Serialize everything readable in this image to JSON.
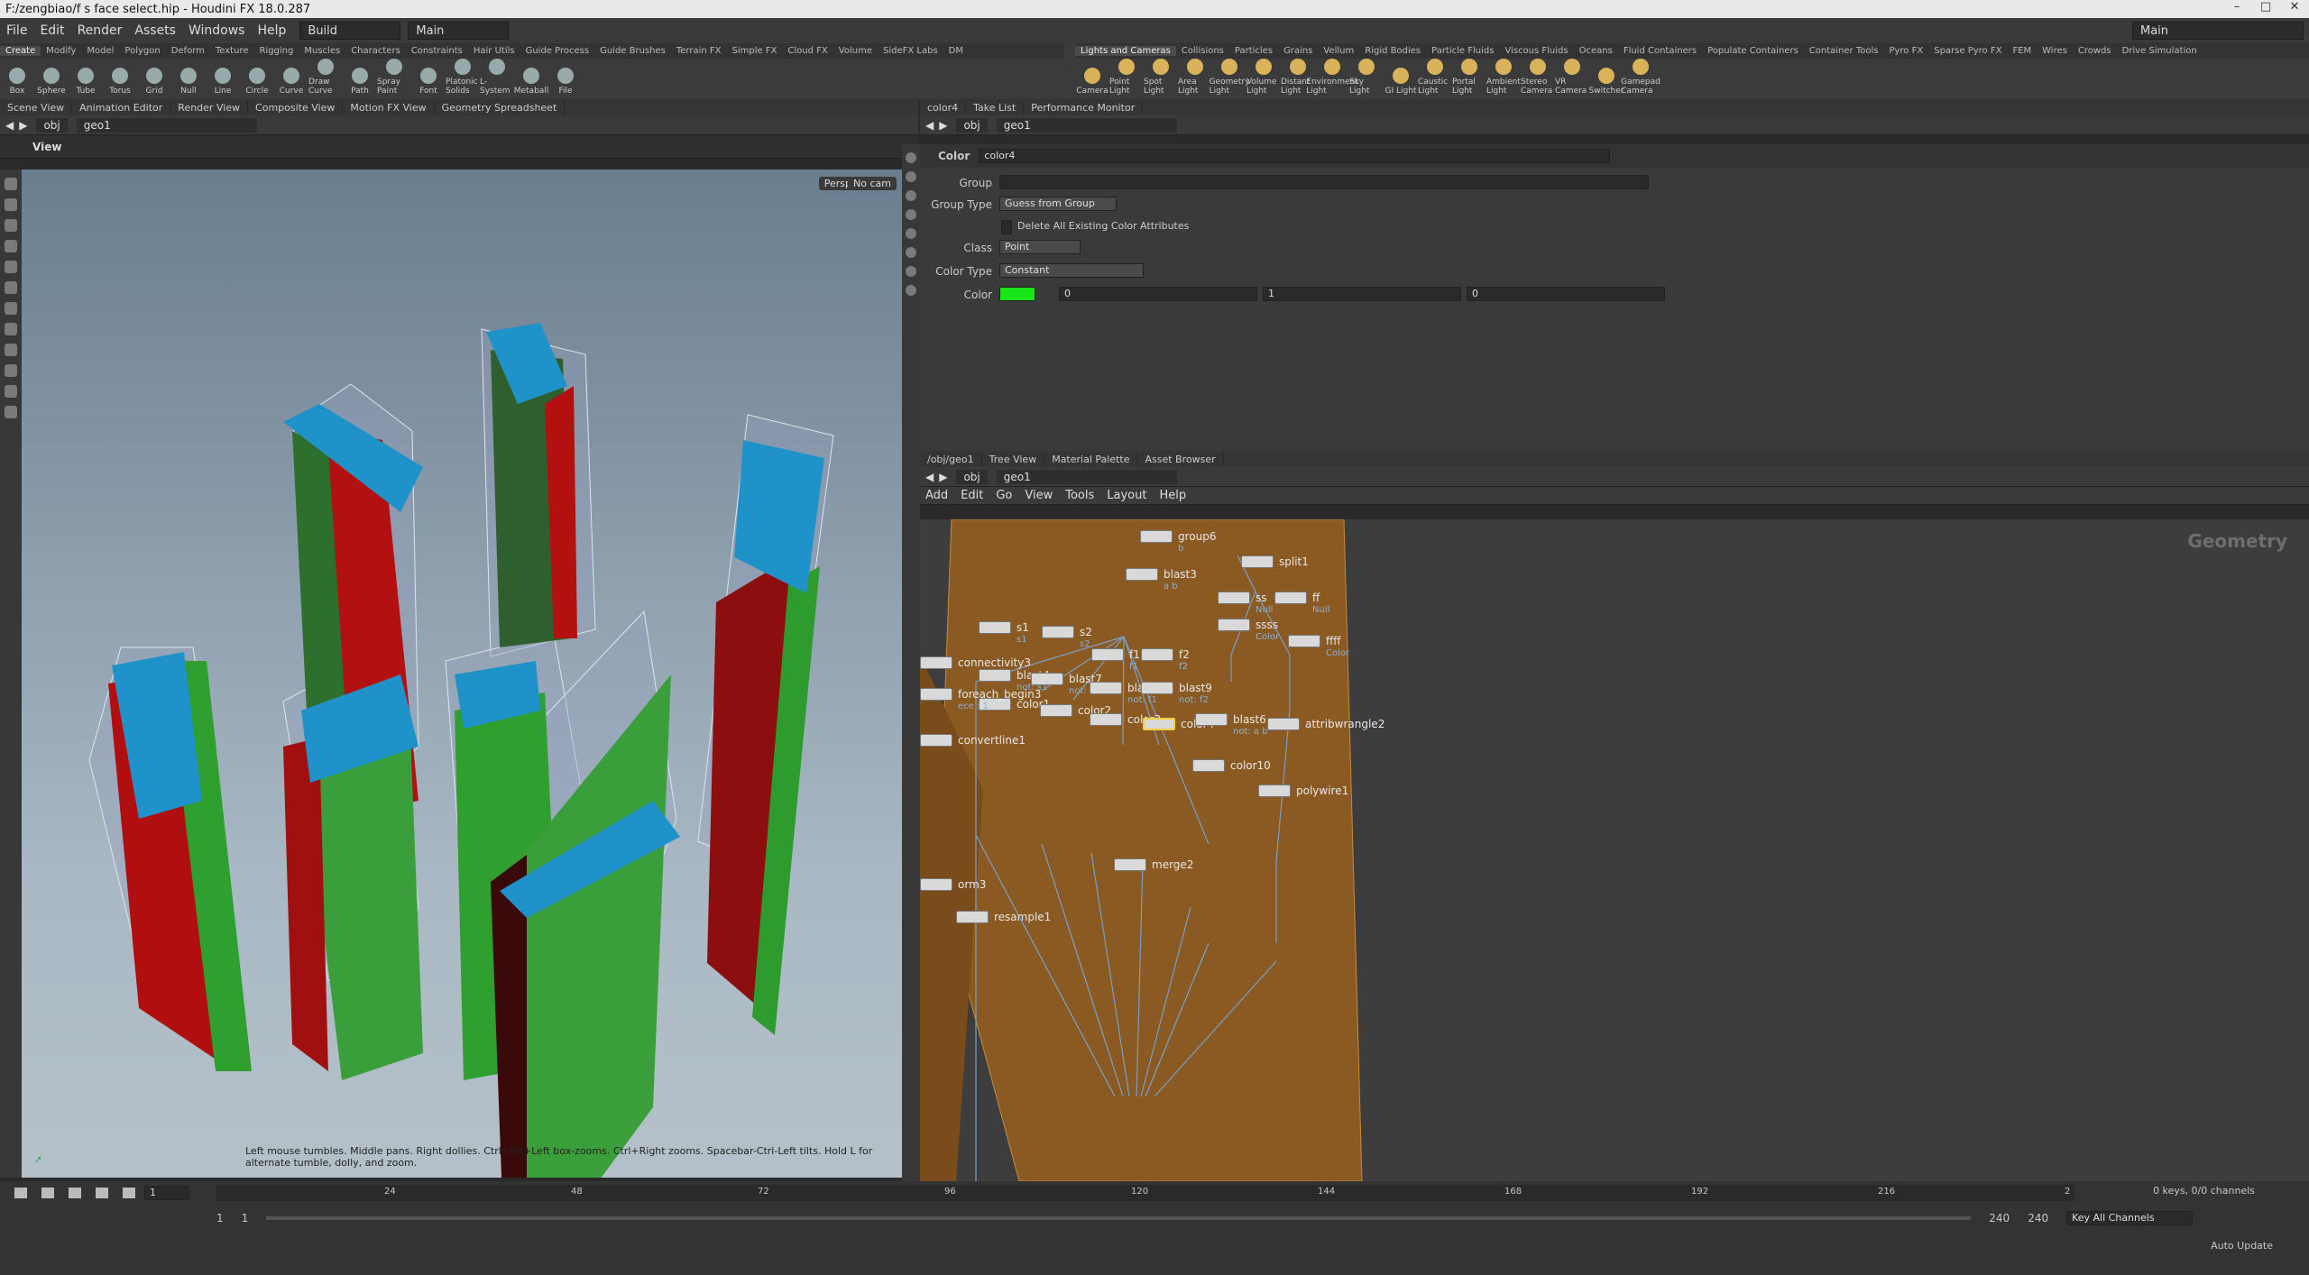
{
  "window": {
    "title": "F:/zengbiao/f s face select.hip - Houdini FX 18.0.287"
  },
  "menu": {
    "items": [
      "File",
      "Edit",
      "Render",
      "Assets",
      "Windows",
      "Help"
    ],
    "desktop": "Build",
    "context": "Main",
    "right_context": "Main"
  },
  "shelf_left": {
    "tabs": [
      "Create",
      "Modify",
      "Model",
      "Polygon",
      "Deform",
      "Texture",
      "Rigging",
      "Muscles",
      "Characters",
      "Constraints",
      "Hair Utils",
      "Guide Process",
      "Guide Brushes",
      "Terrain FX",
      "Simple FX",
      "Cloud FX",
      "Volume",
      "SideFX Labs",
      "DM"
    ],
    "tools": [
      "Box",
      "Sphere",
      "Tube",
      "Torus",
      "Grid",
      "Null",
      "Line",
      "Circle",
      "Curve",
      "Draw Curve",
      "Path",
      "Spray Paint",
      "Font",
      "Platonic Solids",
      "L-System",
      "Metaball",
      "File"
    ]
  },
  "shelf_right": {
    "tabs": [
      "Lights and Cameras",
      "Collisions",
      "Particles",
      "Grains",
      "Vellum",
      "Rigid Bodies",
      "Particle Fluids",
      "Viscous Fluids",
      "Oceans",
      "Fluid Containers",
      "Populate Containers",
      "Container Tools",
      "Pyro FX",
      "Sparse Pyro FX",
      "FEM",
      "Wires",
      "Crowds",
      "Drive Simulation"
    ],
    "tools": [
      "Camera",
      "Point Light",
      "Spot Light",
      "Area Light",
      "Geometry Light",
      "Volume Light",
      "Distant Light",
      "Environment Light",
      "Sky Light",
      "GI Light",
      "Caustic Light",
      "Portal Light",
      "Ambient Light",
      "Stereo Camera",
      "VR Camera",
      "Switcher",
      "Gamepad Camera"
    ]
  },
  "left_pane": {
    "tabs": [
      "Scene View",
      "Animation Editor",
      "Render View",
      "Composite View",
      "Motion FX View",
      "Geometry Spreadsheet"
    ],
    "path": [
      "obj",
      "geo1"
    ],
    "view_label": "View",
    "persp": "Persp",
    "cam": "No cam",
    "hint": "Left mouse tumbles. Middle pans. Right dollies. Ctrl+Alt+Left box-zooms. Ctrl+Right zooms. Spacebar-Ctrl-Left tilts. Hold L for alternate tumble, dolly, and zoom."
  },
  "param_pane": {
    "tabs": [
      "color4",
      "Take List",
      "Performance Monitor"
    ],
    "path": [
      "obj",
      "geo1"
    ],
    "node_type": "Color",
    "node_name": "color4",
    "labels": {
      "group": "Group",
      "group_type": "Group Type",
      "delete": "Delete All Existing Color Attributes",
      "class": "Class",
      "color_type": "Color Type",
      "color": "Color"
    },
    "values": {
      "group_type": "Guess from Group",
      "class": "Point",
      "color_type": "Constant",
      "r": "0",
      "g": "1",
      "b": "0"
    },
    "swatch": "#19e619"
  },
  "net_pane": {
    "tabs": [
      "/obj/geo1",
      "Tree View",
      "Material Palette",
      "Asset Browser"
    ],
    "path": [
      "obj",
      "geo1"
    ],
    "menu": [
      "Add",
      "Edit",
      "Go",
      "View",
      "Tools",
      "Layout",
      "Help"
    ],
    "context_label": "Geometry",
    "nodes": [
      {
        "name": "group6",
        "sub": "b"
      },
      {
        "name": "blast3",
        "sub": "a b"
      },
      {
        "name": "split1",
        "sub": ""
      },
      {
        "name": "ss",
        "sub": "Null"
      },
      {
        "name": "ff",
        "sub": "Null"
      },
      {
        "name": "ssss",
        "sub": "Color"
      },
      {
        "name": "ffff",
        "sub": "Color"
      },
      {
        "name": "s1",
        "sub": "s1"
      },
      {
        "name": "s2",
        "sub": "s2"
      },
      {
        "name": "f1",
        "sub": "f1"
      },
      {
        "name": "f2",
        "sub": "f2"
      },
      {
        "name": "blast4",
        "sub": "not: s1"
      },
      {
        "name": "blast7",
        "sub": "not: s2"
      },
      {
        "name": "blast",
        "sub": "not: f1"
      },
      {
        "name": "blast9",
        "sub": "not: f2"
      },
      {
        "name": "color1",
        "sub": ""
      },
      {
        "name": "color2",
        "sub": ""
      },
      {
        "name": "color3",
        "sub": ""
      },
      {
        "name": "color4",
        "sub": ""
      },
      {
        "name": "blast6",
        "sub": "not: a b"
      },
      {
        "name": "attribwrangle2",
        "sub": ""
      },
      {
        "name": "color10",
        "sub": ""
      },
      {
        "name": "polywire1",
        "sub": ""
      },
      {
        "name": "merge2",
        "sub": ""
      },
      {
        "name": "connectivity3",
        "sub": ""
      },
      {
        "name": "foreach_begin3",
        "sub": "ece : 1"
      },
      {
        "name": "convertline1",
        "sub": ""
      },
      {
        "name": "orm3",
        "sub": ""
      },
      {
        "name": "resample1",
        "sub": ""
      }
    ]
  },
  "timeline": {
    "frame": "1",
    "ticks": [
      "24",
      "48",
      "72",
      "96",
      "120",
      "144",
      "168",
      "192",
      "216",
      "2"
    ],
    "start": "1",
    "start2": "1",
    "end": "240",
    "end2": "240",
    "channels": "0 keys, 0/0 channels",
    "key_all": "Key All Channels",
    "auto_update": "Auto Update"
  }
}
